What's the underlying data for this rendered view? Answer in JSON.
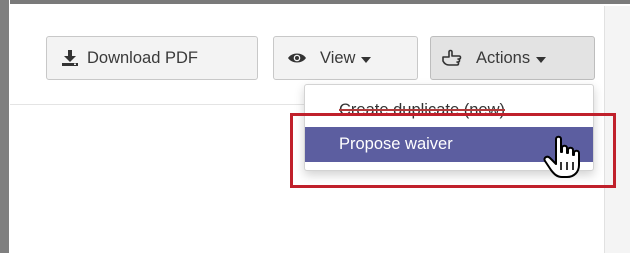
{
  "toolbar": {
    "download_label": "Download PDF",
    "view_label": "View",
    "actions_label": "Actions",
    "download_icon": "download-icon",
    "view_icon": "eye-icon",
    "actions_icon": "pointing-hand-icon"
  },
  "actions_menu": {
    "items": [
      {
        "label": "Create duplicate (new)"
      },
      {
        "label": "Propose waiver"
      }
    ]
  },
  "colors": {
    "menu_highlight": "#5c5ea0",
    "callout_border": "#c0202b",
    "button_bg": "#f3f3f3"
  }
}
